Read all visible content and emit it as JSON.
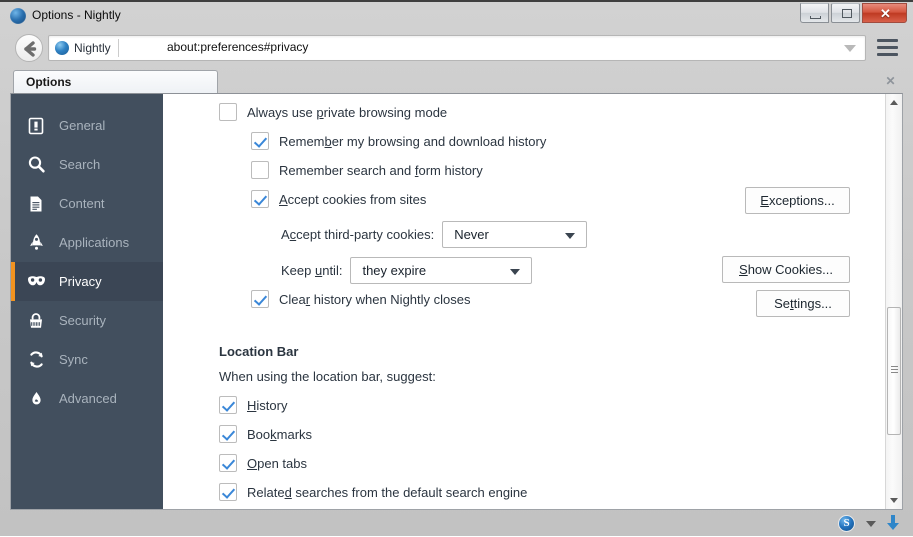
{
  "window": {
    "title": "Options - Nightly",
    "icon": "firefox-globe-icon",
    "buttons": {
      "minimize": "minimize-button",
      "maximize": "maximize-button",
      "close_glyph": "✕"
    }
  },
  "navbar": {
    "back_label": "back-button",
    "identity_label": "Nightly",
    "url": "about:preferences#privacy",
    "menu_label": "menu-button"
  },
  "tabs": {
    "items": [
      {
        "label": "Options",
        "active": true
      }
    ],
    "close_glyph": "✕"
  },
  "sidebar": {
    "items": [
      {
        "label": "General",
        "icon": "general-icon",
        "active": false
      },
      {
        "label": "Search",
        "icon": "search-icon",
        "active": false
      },
      {
        "label": "Content",
        "icon": "content-icon",
        "active": false
      },
      {
        "label": "Applications",
        "icon": "applications-icon",
        "active": false
      },
      {
        "label": "Privacy",
        "icon": "privacy-mask-icon",
        "active": true
      },
      {
        "label": "Security",
        "icon": "security-lock-icon",
        "active": false
      },
      {
        "label": "Sync",
        "icon": "sync-icon",
        "active": false
      },
      {
        "label": "Advanced",
        "icon": "advanced-icon",
        "active": false
      }
    ],
    "accent_color": "#f29320",
    "background_color": "#424f5e",
    "active_background_color": "#3b4655"
  },
  "main": {
    "history_options": [
      {
        "label": "Always use private browsing mode",
        "checked": false,
        "accel": "p"
      },
      {
        "label": "Remember my browsing and download history",
        "checked": true,
        "accel": "b"
      },
      {
        "label": "Remember search and form history",
        "checked": false,
        "accel": "f"
      },
      {
        "label": "Accept cookies from sites",
        "checked": true,
        "accel": "A"
      }
    ],
    "third_party_label": "Accept third-party cookies:",
    "third_party_accel": "c",
    "third_party_value": "Never",
    "keep_until_label": "Keep until:",
    "keep_until_accel": "u",
    "keep_until_value": "they expire",
    "clear_history_label": "Clear history when Nightly closes",
    "clear_history_accel": "r",
    "clear_history_checked": true,
    "buttons": {
      "exceptions": "Exceptions...",
      "show_cookies": "Show Cookies...",
      "settings": "Settings..."
    },
    "location_bar": {
      "title": "Location Bar",
      "subtitle": "When using the location bar, suggest:",
      "options": [
        {
          "label": "History",
          "checked": true,
          "accel": "H"
        },
        {
          "label": "Bookmarks",
          "checked": true,
          "accel": "k"
        },
        {
          "label": "Open tabs",
          "checked": true,
          "accel": "O"
        },
        {
          "label": "Related searches from the default search engine",
          "checked": true,
          "accel": "d"
        }
      ]
    },
    "checkbox_accent_color": "#3a87d8"
  },
  "statusbar": {
    "sync_badge": "S",
    "dropdown": "status-dropdown",
    "download": "download-arrow-icon"
  }
}
